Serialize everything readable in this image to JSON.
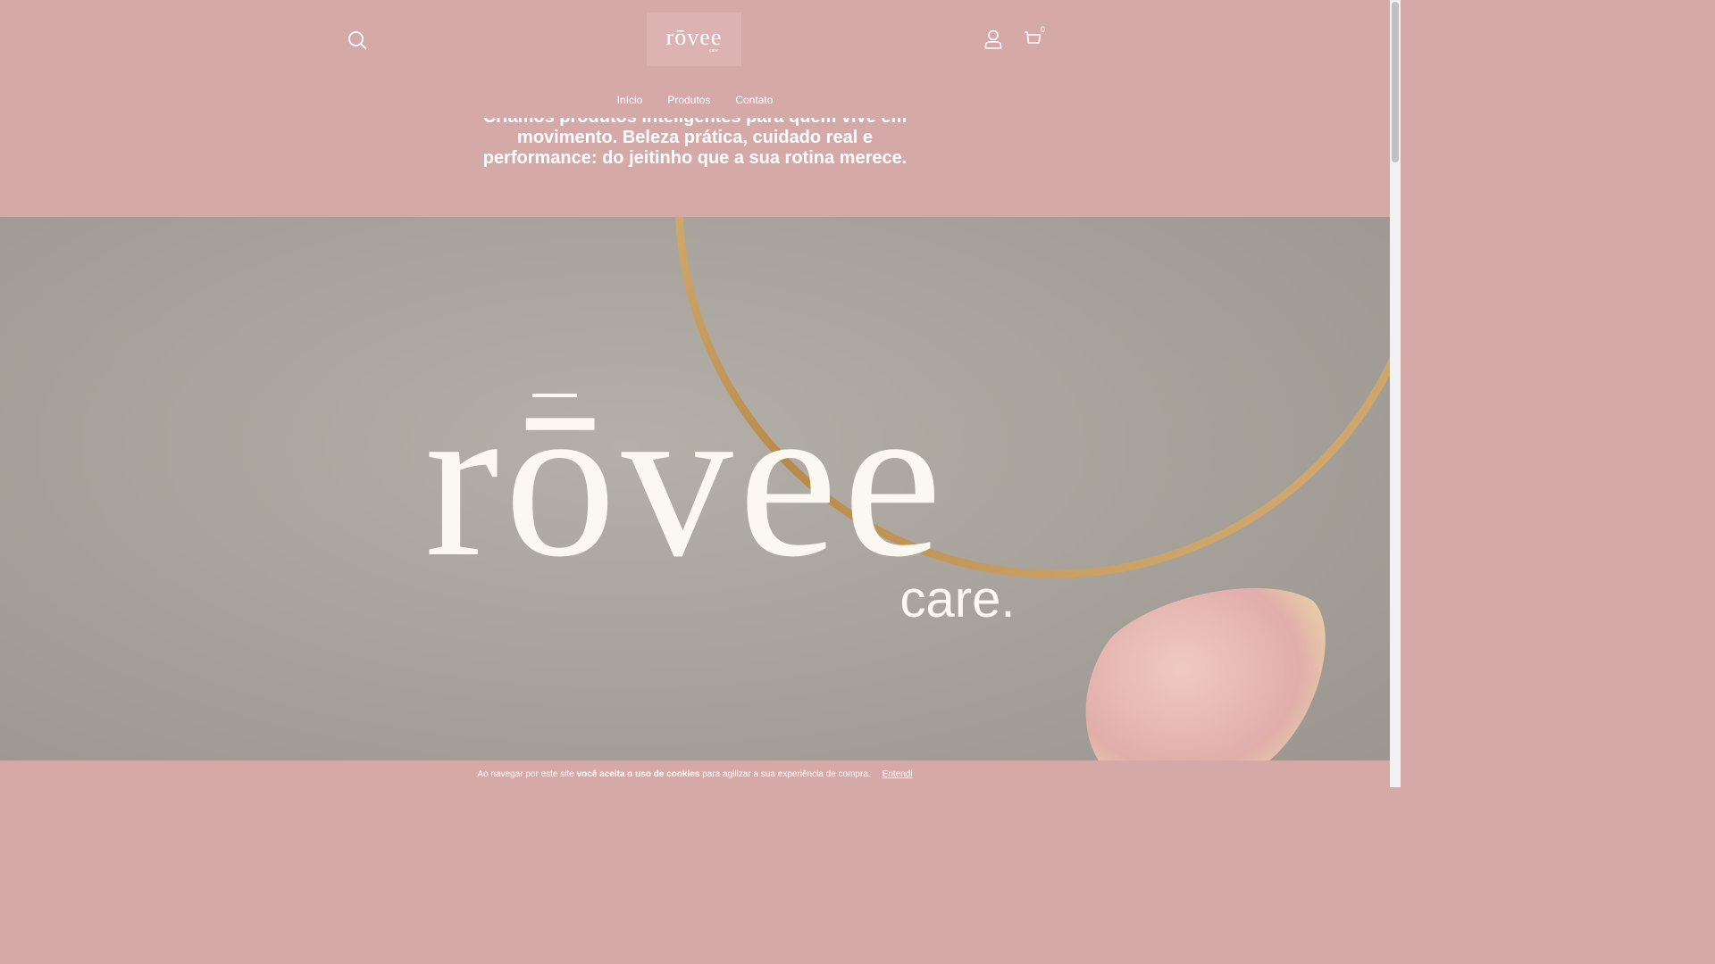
{
  "header": {
    "logo_text": "rōvee",
    "logo_subtext": "care",
    "cart_count": "0"
  },
  "nav": {
    "items": [
      {
        "label": "Início"
      },
      {
        "label": "Produtos"
      },
      {
        "label": "Contato"
      }
    ]
  },
  "intro": {
    "text": "Criamos produtos inteligentes para quem vive em movimento. Beleza prática, cuidado real e performance: do jeitinho que a sua rotina merece."
  },
  "hero": {
    "brand_word": "rōvee",
    "brand_tagline": "care."
  },
  "cookie": {
    "text_before": "Ao navegar por este site",
    "text_bold": "você aceita o uso de cookies",
    "text_after": "para agilizar a sua experiência de compra.",
    "accept_label": "Entendi"
  },
  "colors": {
    "brand_pink": "#d6a9a9",
    "hero_gray": "#a8a39c",
    "gold": "#c9a56a",
    "petal": "#e4b8b4"
  }
}
